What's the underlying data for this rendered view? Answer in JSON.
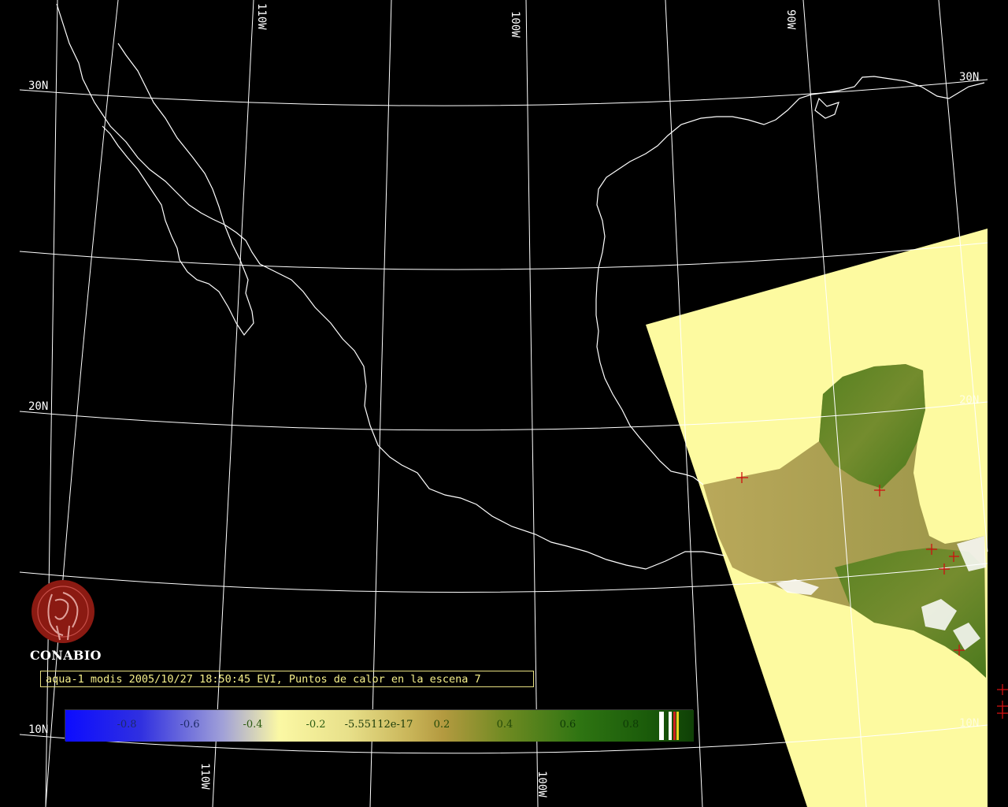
{
  "map": {
    "graticule_labels": {
      "lat": [
        "30N",
        "20N",
        "10N"
      ],
      "lon": [
        "110W",
        "100W",
        "90W"
      ]
    },
    "scene_colors": {
      "land_cover": "#fdfaa0",
      "vegetation": "#3e7a12",
      "outline": "#ffffff",
      "grid": "#ffffff",
      "hotspot": "#d01010"
    }
  },
  "logo": {
    "name": "CONABIO"
  },
  "caption": "aqua-1 modis 2005/10/27 18:50:45 EVI, Puntos de calor en la escena 7",
  "colorbar": {
    "ticks": [
      "-0.8",
      "-0.6",
      "-0.4",
      "-0.2",
      "-5.55112e-17",
      "0.2",
      "0.4",
      "0.6",
      "0.8"
    ],
    "colors": {
      "low": "#1010ff",
      "mid": "#fbf8a4",
      "high": "#1a5a0a"
    }
  }
}
